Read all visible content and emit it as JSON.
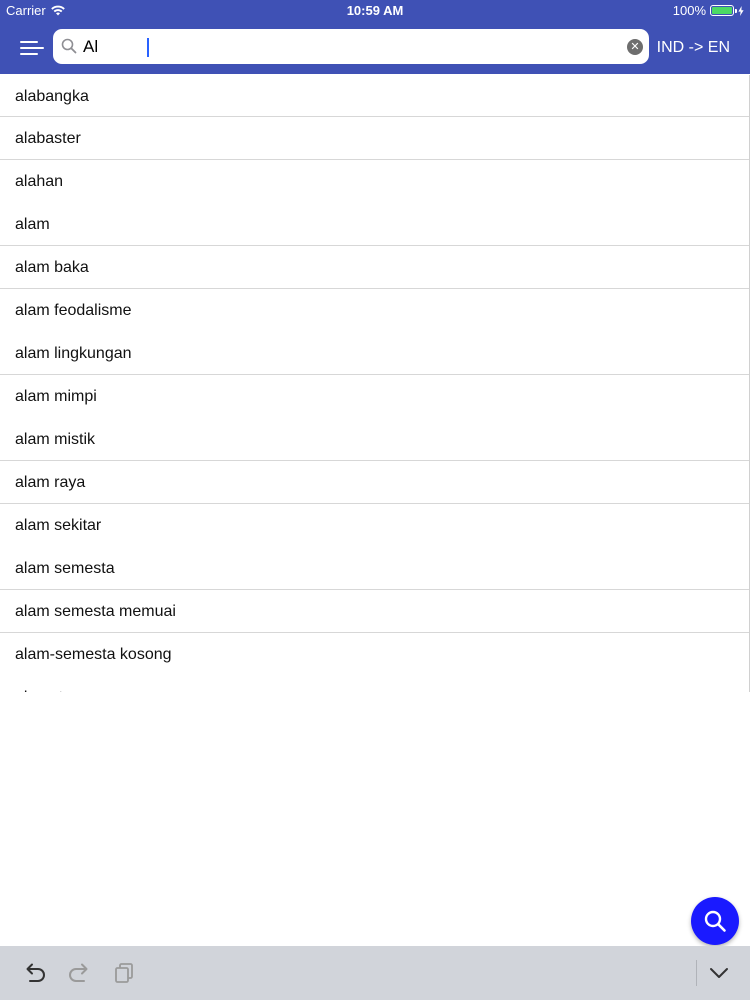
{
  "status_bar": {
    "carrier": "Carrier",
    "time": "10:59 AM",
    "battery": "100%"
  },
  "header": {
    "search_value": "Al",
    "language": "IND -> EN"
  },
  "results": [
    "alabangka",
    "alabaster",
    "alahan",
    "alam",
    "alam baka",
    "alam feodalisme",
    "alam lingkungan",
    "alam mimpi",
    "alam mistik",
    "alam raya",
    "alam sekitar",
    "alam semesta",
    "alam semesta memuai",
    "alam-semesta kosong",
    "alamat"
  ],
  "colors": {
    "header": "#3f51b5",
    "fab": "#1a1aff",
    "keyboard_bar": "#d1d4da",
    "caret": "#2962ff"
  },
  "icons": {
    "menu": "hamburger-icon",
    "search": "search-icon",
    "clear": "clear-icon",
    "fab": "search-icon",
    "undo": "undo-icon",
    "redo": "redo-icon",
    "paste": "paste-icon",
    "dismiss": "chevron-down-icon"
  }
}
